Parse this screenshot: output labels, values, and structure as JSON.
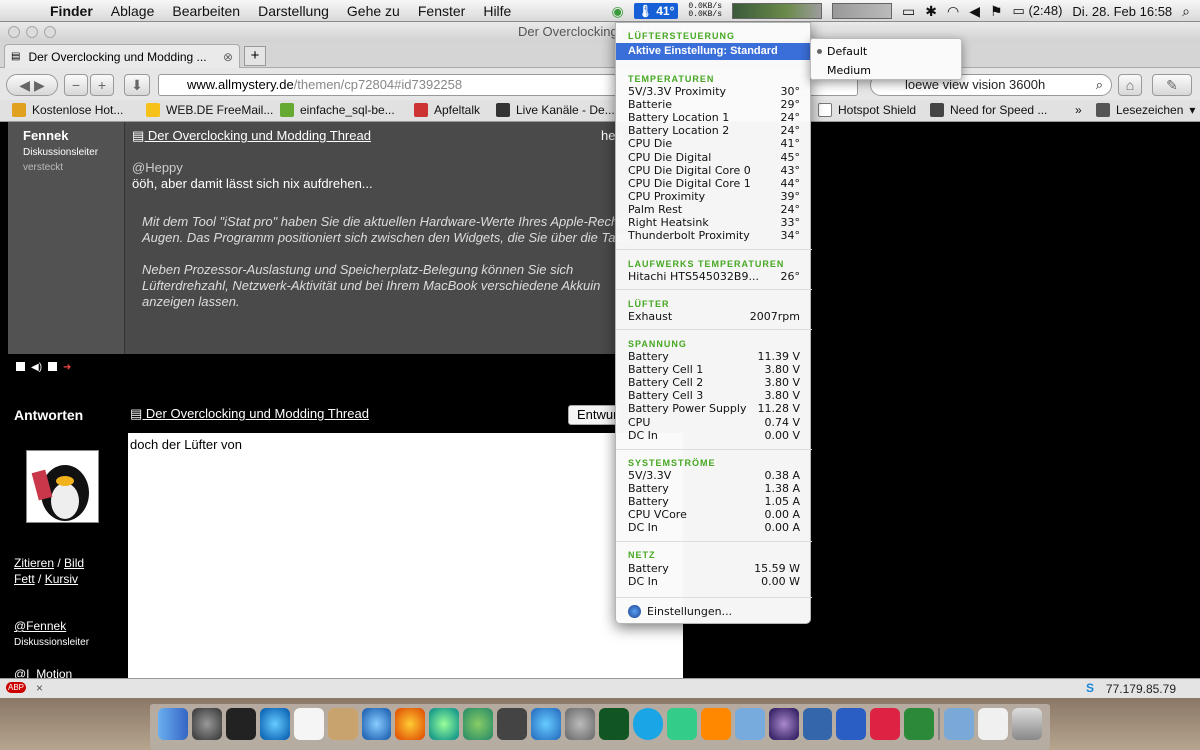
{
  "menubar": {
    "app": "Finder",
    "items": [
      "Ablage",
      "Bearbeiten",
      "Darstellung",
      "Gehe zu",
      "Fenster",
      "Hilfe"
    ],
    "istat_temp": "41°",
    "net_up": "0.0KB/s",
    "net_down": "0.0KB/s",
    "battery_time": "(2:48)",
    "datetime": "Di. 28. Feb  16:58"
  },
  "browser": {
    "window_title": "Der Overclocking und Moddi",
    "tab_label": "Der Overclocking und Modding ...",
    "newtab": "+",
    "url_domain": "www.allmystery.de",
    "url_path": "/themen/cp72804#id7392258",
    "search_value": "loewe view vision 3600h",
    "bookmarks": [
      "Kostenlose Hot...",
      "WEB.DE FreeMail...",
      "einfache_sql-be...",
      "Apfeltalk",
      "Live Kanäle - De...",
      "Hotspot Shield",
      "Need for Speed ...",
      "Lesezeichen"
    ],
    "bookmarks_overflow": "»"
  },
  "page": {
    "user_name": "Fennek",
    "user_role": "Diskussionsleiter",
    "user_hidden": "versteckt",
    "post_title": "Der Overclocking und Modding Thread",
    "post_time": "heu",
    "quote_to": "@Heppy",
    "post_text": "ööh, aber damit lässt sich nix aufdrehen...",
    "quote_lines": [
      "Mit dem Tool \"iStat pro\" haben Sie die aktuellen Hardware-Werte Ihres Apple-Rechne",
      "Augen. Das Programm positioniert sich zwischen den Widgets, die Sie über die Taste F4",
      "",
      "Neben    Prozessor-Auslastung    und    Speicherplatz-Belegung    können    Sie    sich",
      "Lüfterdrehzahl,  Netzwerk-Aktivität  und  bei  Ihrem  MacBook  verschiedene  Akkuin",
      "anzeigen lassen."
    ],
    "reply_heading": "Antworten",
    "reply_title": "Der Overclocking und Modding Thread",
    "draft_button": "Entwur",
    "editor_text": "doch der Lüfter von",
    "link_zitieren": "Zitieren",
    "link_bild": "Bild",
    "link_fett": "Fett",
    "link_kursiv": "Kursiv",
    "slash": "/",
    "mention": "@Fennek",
    "mention_role": "Diskussionsleiter",
    "mention2": "@I_Motion"
  },
  "statusbar": {
    "abp": "ABP",
    "close": "×",
    "ip": "77.179.85.79",
    "skype": "S"
  },
  "istat": {
    "fan_control_head": "LÜFTERSTEUERUNG",
    "fan_active": "Aktive Einstellung: Standard",
    "temp_head": "TEMPERATUREN",
    "temps": [
      {
        "label": "5V/3.3V Proximity",
        "value": "30°"
      },
      {
        "label": "Batterie",
        "value": "29°"
      },
      {
        "label": "Battery Location 1",
        "value": "24°"
      },
      {
        "label": "Battery Location 2",
        "value": "24°"
      },
      {
        "label": "CPU Die",
        "value": "41°"
      },
      {
        "label": "CPU Die Digital",
        "value": "45°"
      },
      {
        "label": "CPU Die Digital Core 0",
        "value": "43°"
      },
      {
        "label": "CPU Die Digital Core 1",
        "value": "44°"
      },
      {
        "label": "CPU Proximity",
        "value": "39°"
      },
      {
        "label": "Palm Rest",
        "value": "24°"
      },
      {
        "label": "Right Heatsink",
        "value": "33°"
      },
      {
        "label": "Thunderbolt Proximity",
        "value": "34°"
      }
    ],
    "drive_head": "LAUFWERKS TEMPERATUREN",
    "drives": [
      {
        "label": "Hitachi HTS545032B9...",
        "value": "26°"
      }
    ],
    "fan_head": "LÜFTER",
    "fans": [
      {
        "label": "Exhaust",
        "value": "2007rpm"
      }
    ],
    "volt_head": "SPANNUNG",
    "volts": [
      {
        "label": "Battery",
        "value": "11.39 V"
      },
      {
        "label": "Battery Cell 1",
        "value": "3.80 V"
      },
      {
        "label": "Battery Cell 2",
        "value": "3.80 V"
      },
      {
        "label": "Battery Cell 3",
        "value": "3.80 V"
      },
      {
        "label": "Battery Power Supply",
        "value": "11.28 V"
      },
      {
        "label": "CPU",
        "value": "0.74 V"
      },
      {
        "label": "DC In",
        "value": "0.00 V"
      }
    ],
    "current_head": "SYSTEMSTRÖME",
    "currents": [
      {
        "label": "5V/3.3V",
        "value": "0.38 A"
      },
      {
        "label": "Battery",
        "value": "1.38 A"
      },
      {
        "label": "Battery",
        "value": "1.05 A"
      },
      {
        "label": "CPU VCore",
        "value": "0.00 A"
      },
      {
        "label": "DC In",
        "value": "0.00 A"
      }
    ],
    "power_head": "NETZ",
    "power": [
      {
        "label": "Battery",
        "value": "15.59 W"
      },
      {
        "label": "DC In",
        "value": "0.00 W"
      }
    ],
    "settings": "Einstellungen..."
  },
  "submenu": {
    "options": [
      "Default",
      "Medium"
    ],
    "selected": "Default"
  }
}
